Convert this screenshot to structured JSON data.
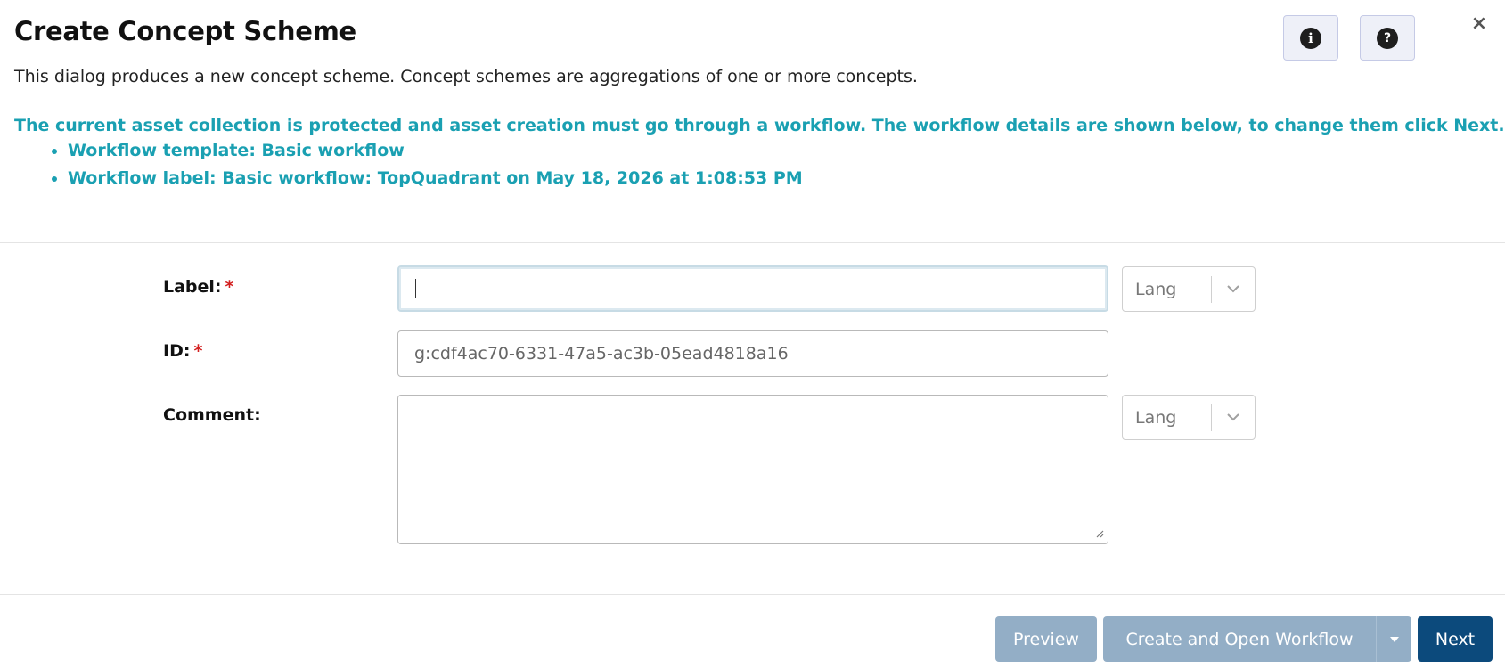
{
  "dialog": {
    "title": "Create Concept Scheme",
    "description": "This dialog produces a new concept scheme. Concept schemes are aggregations of one or more concepts.",
    "close_symbol": "×"
  },
  "top_actions": {
    "info_symbol": "i",
    "help_symbol": "?"
  },
  "notice": {
    "message": "The current asset collection is protected and asset creation must go through a workflow. The workflow details are shown below, to change them click Next.",
    "items": [
      "Workflow template: Basic workflow",
      "Workflow label: Basic workflow: TopQuadrant on May 18, 2026 at 1:08:53 PM"
    ]
  },
  "form": {
    "label": {
      "label": "Label:",
      "required_mark": "*",
      "value": "",
      "lang_placeholder": "Lang"
    },
    "id": {
      "label": "ID:",
      "required_mark": "*",
      "value": "g:cdf4ac70-6331-47a5-ac3b-05ead4818a16"
    },
    "comment": {
      "label": "Comment:",
      "value": "",
      "lang_placeholder": "Lang"
    }
  },
  "footer": {
    "preview_label": "Preview",
    "create_label": "Create and Open Workflow",
    "next_label": "Next"
  },
  "colors": {
    "accent_teal": "#1aa0b2",
    "primary_button": "#0c4a7c",
    "muted_button": "#93aec6",
    "required": "#d32020"
  },
  "icons": {
    "info": "info-circle-icon",
    "help": "question-circle-icon",
    "close": "close-icon",
    "lang_chevron": "chevron-down-icon",
    "create_dropdown": "caret-down-icon"
  }
}
